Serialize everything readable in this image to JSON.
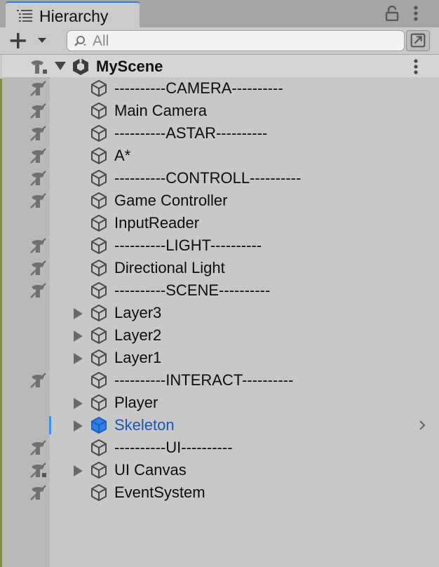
{
  "tab": {
    "title": "Hierarchy",
    "icon": "list-icon"
  },
  "toolbar": {
    "create_icon": "plus-icon",
    "search_placeholder": "All",
    "search_icon": "search-icon",
    "scene_search_icon": "window-link-icon"
  },
  "scene": {
    "name": "MyScene",
    "icon": "unity-scene-icon",
    "expanded": true
  },
  "colors": {
    "accent": "#3a79d8",
    "selected_text": "#1a55b8",
    "selected_icon": "#2f7fe6",
    "selection_bar": "#3c8ff0"
  },
  "rows": [
    {
      "label": "----------CAMERA----------",
      "expandable": false,
      "vis_hidden": true
    },
    {
      "label": "Main Camera",
      "expandable": false,
      "vis_hidden": true
    },
    {
      "label": "----------ASTAR----------",
      "expandable": false,
      "vis_hidden": true
    },
    {
      "label": "A*",
      "expandable": false,
      "vis_hidden": true
    },
    {
      "label": "----------CONTROLL----------",
      "expandable": false,
      "vis_hidden": true
    },
    {
      "label": "Game Controller",
      "expandable": false,
      "vis_hidden": true
    },
    {
      "label": "InputReader",
      "expandable": false,
      "vis_hidden": false
    },
    {
      "label": "----------LIGHT----------",
      "expandable": false,
      "vis_hidden": true
    },
    {
      "label": "Directional Light",
      "expandable": false,
      "vis_hidden": true
    },
    {
      "label": "----------SCENE----------",
      "expandable": false,
      "vis_hidden": true
    },
    {
      "label": "Layer3",
      "expandable": true,
      "vis_hidden": false
    },
    {
      "label": "Layer2",
      "expandable": true,
      "vis_hidden": false
    },
    {
      "label": "Layer1",
      "expandable": true,
      "vis_hidden": false
    },
    {
      "label": "----------INTERACT----------",
      "expandable": false,
      "vis_hidden": true
    },
    {
      "label": "Player",
      "expandable": true,
      "vis_hidden": false
    },
    {
      "label": "Skeleton",
      "expandable": true,
      "vis_hidden": false,
      "selected": true
    },
    {
      "label": "----------UI----------",
      "expandable": false,
      "vis_hidden": true
    },
    {
      "label": "UI Canvas",
      "expandable": true,
      "vis_hidden": true,
      "vis_mixed": true
    },
    {
      "label": "EventSystem",
      "expandable": false,
      "vis_hidden": true
    }
  ]
}
